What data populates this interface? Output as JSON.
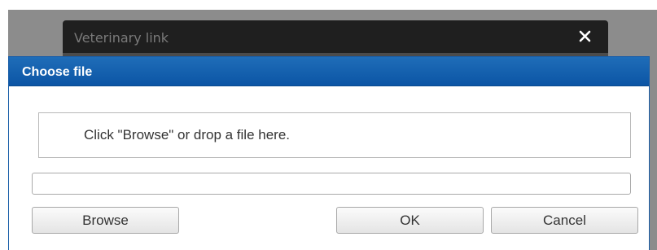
{
  "background_dialog": {
    "title": "Veterinary link",
    "close_icon": "close-icon",
    "close_glyph": "✕"
  },
  "dialog": {
    "title": "Choose file",
    "drop_zone_text": "Click \"Browse\" or drop a file here.",
    "file_path_value": "",
    "browse_label": "Browse",
    "ok_label": "OK",
    "cancel_label": "Cancel"
  },
  "colors": {
    "titlebar": "#0c55a5",
    "overlay": "#8c8c8c",
    "background_dialog": "#1f1f1f"
  }
}
